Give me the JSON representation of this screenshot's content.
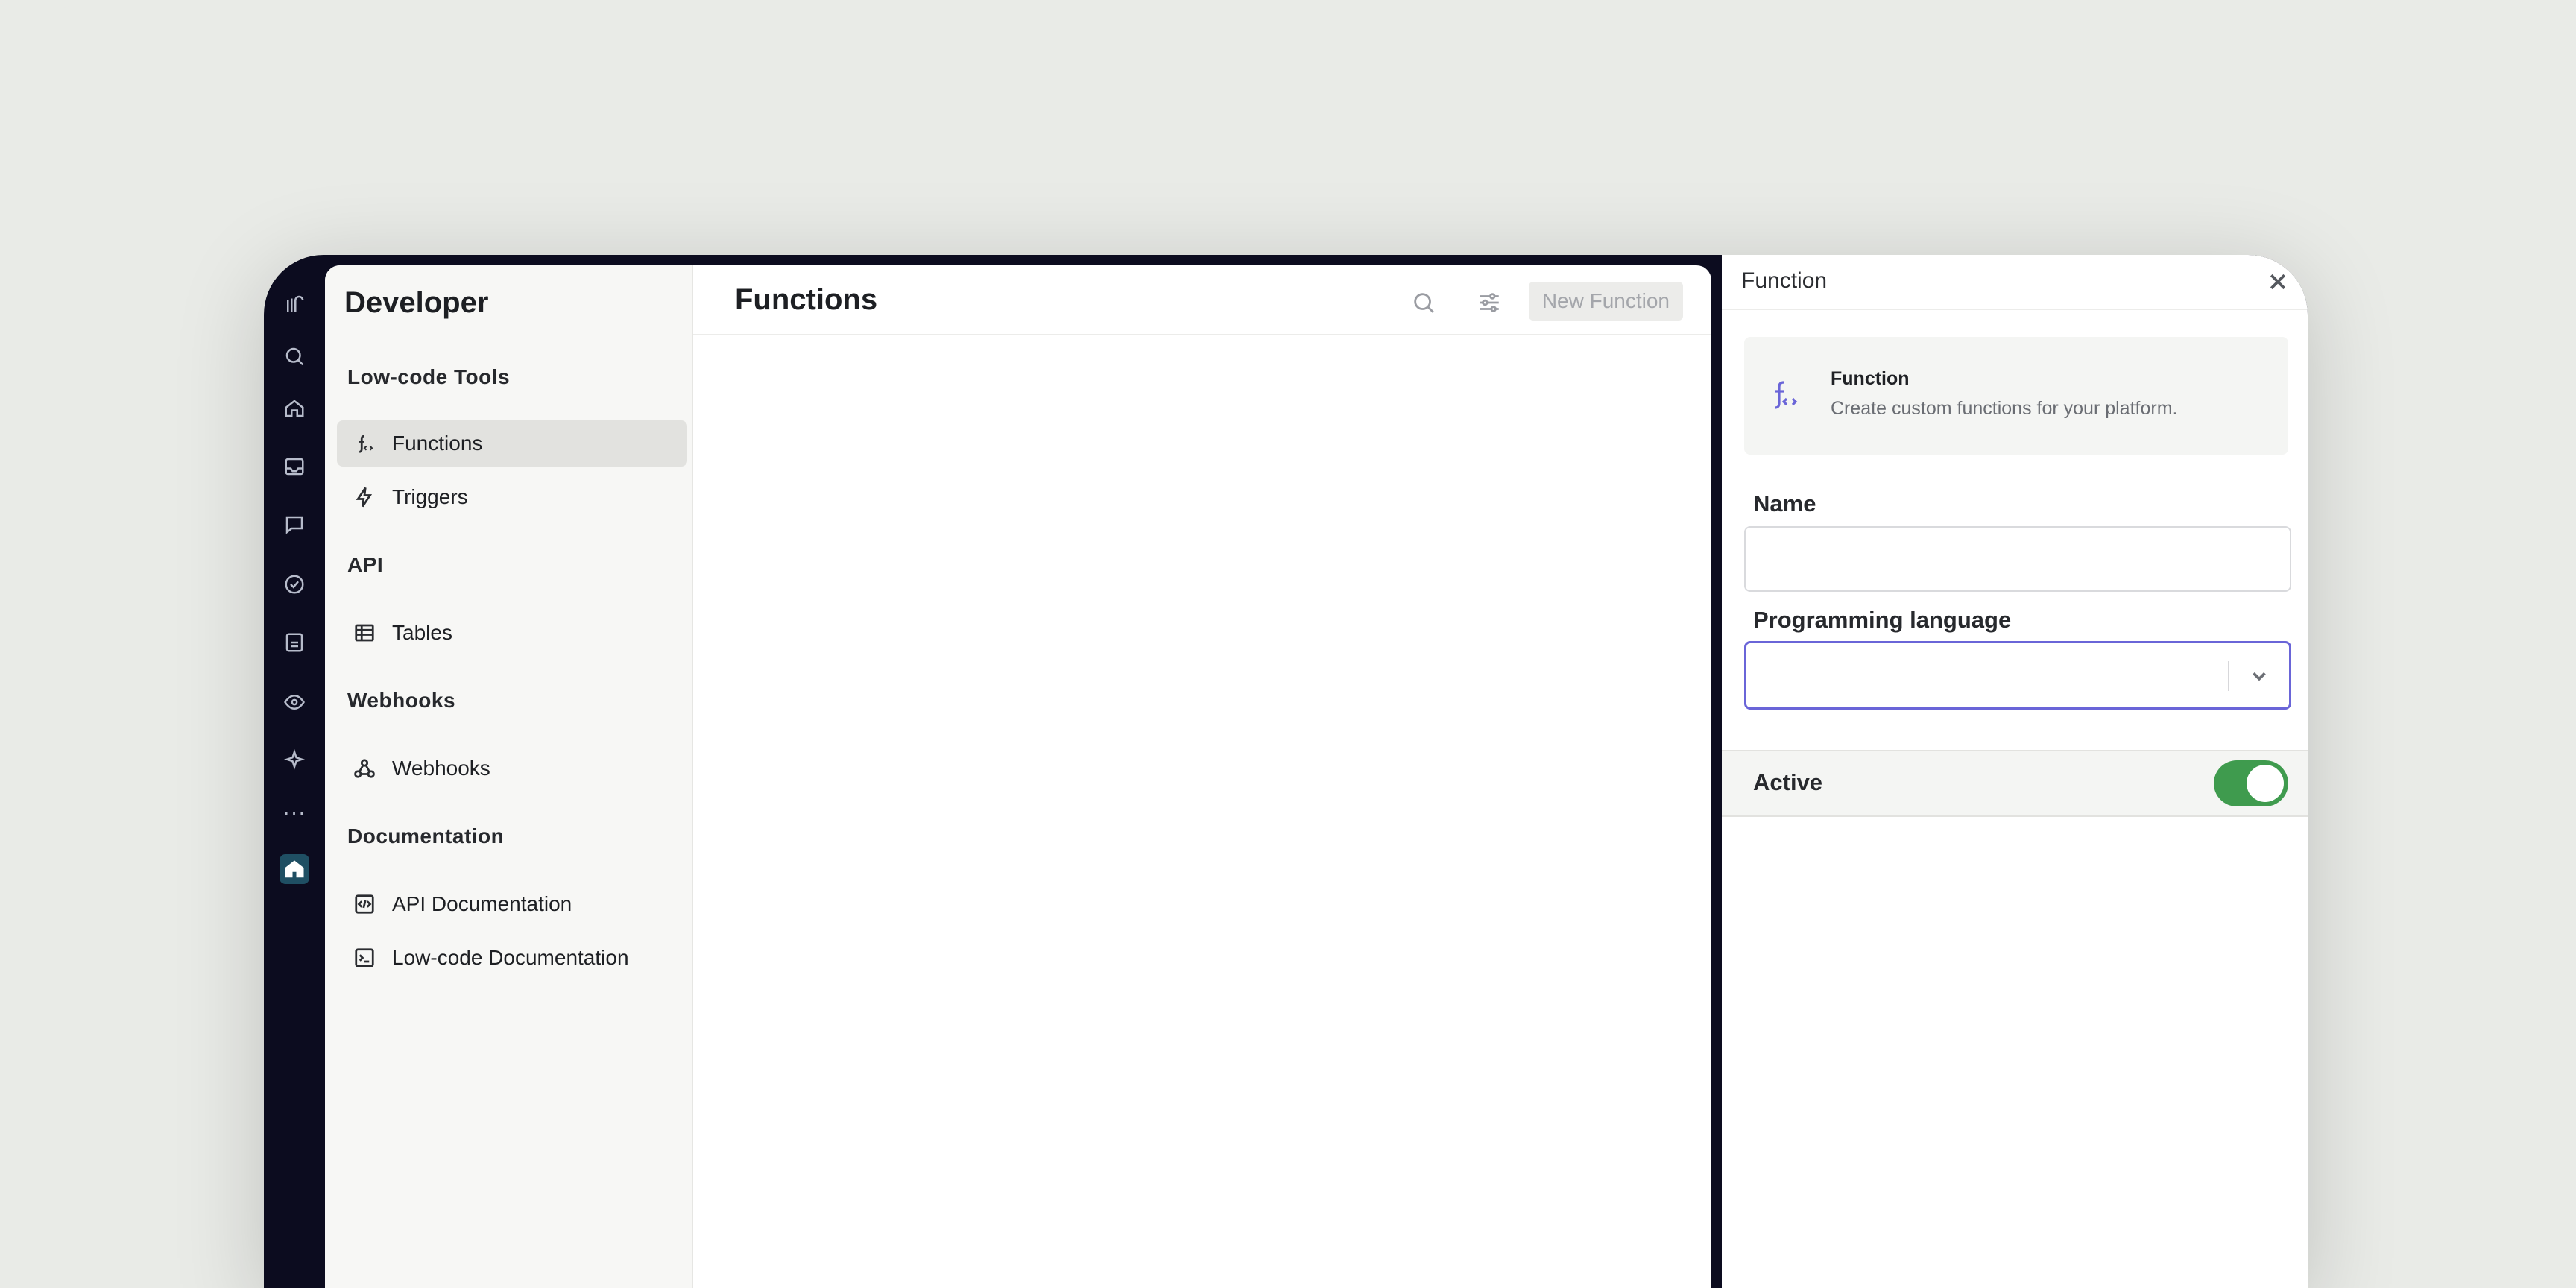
{
  "sidebar": {
    "title": "Developer",
    "sections": [
      {
        "title": "Low-code Tools",
        "items": [
          {
            "label": "Functions",
            "icon": "function-icon",
            "selected": true
          },
          {
            "label": "Triggers",
            "icon": "lightning-icon"
          }
        ]
      },
      {
        "title": "API",
        "items": [
          {
            "label": "Tables",
            "icon": "table-icon"
          }
        ]
      },
      {
        "title": "Webhooks",
        "items": [
          {
            "label": "Webhooks",
            "icon": "webhook-icon"
          }
        ]
      },
      {
        "title": "Documentation",
        "items": [
          {
            "label": "API Documentation",
            "icon": "code-icon"
          },
          {
            "label": "Low-code Documentation",
            "icon": "terminal-icon"
          }
        ]
      }
    ]
  },
  "main": {
    "title": "Functions",
    "new_button_label": "New Function"
  },
  "panel": {
    "title": "Function",
    "card_title": "Function",
    "card_description": "Create custom functions for your platform.",
    "name_label": "Name",
    "name_value": "",
    "language_label": "Programming language",
    "language_value": "",
    "active_label": "Active",
    "active": true
  },
  "colors": {
    "background": "#e9ebe7",
    "rail": "#0c0c1f",
    "sidebar": "#f7f7f5",
    "accent": "#6a65d8",
    "toggle_on": "#3f9b4e"
  }
}
